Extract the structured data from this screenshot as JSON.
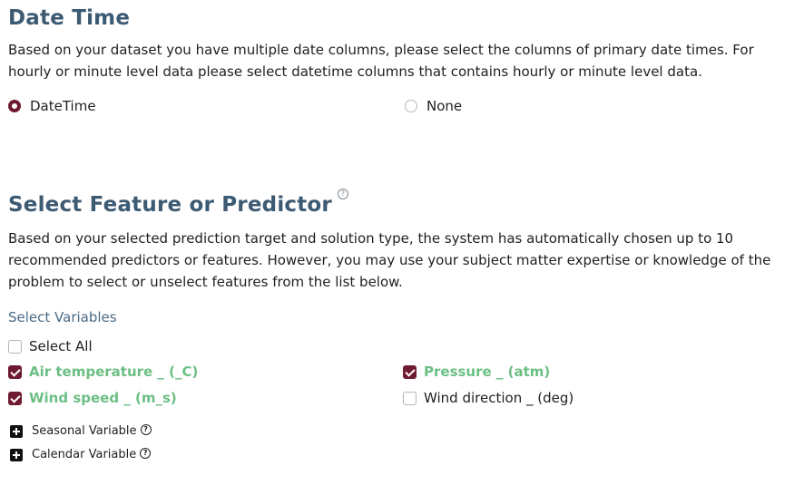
{
  "date_time": {
    "title": "Date Time",
    "description": "Based on your dataset you have multiple date columns, please select the columns of primary date times. For hourly or minute level data please select datetime columns that contains hourly or minute level data.",
    "options": [
      {
        "label": "DateTime",
        "selected": true
      },
      {
        "label": "None",
        "selected": false
      }
    ]
  },
  "feature_section": {
    "title": "Select Feature or Predictor",
    "help_icon": "question-circle-icon",
    "description": "Based on your selected prediction target and solution type, the system has automatically chosen up to 10 recommended predictors or features. However, you may use your subject matter expertise or knowledge of the problem to select or unselect features from the list below.",
    "select_variables_label": "Select Variables",
    "select_all_label": "Select All",
    "variables": [
      {
        "label": "Air temperature _ (_C)",
        "checked": true
      },
      {
        "label": "Pressure _ (atm)",
        "checked": true
      },
      {
        "label": "Wind speed _ (m_s)",
        "checked": true
      },
      {
        "label": "Wind direction _ (deg)",
        "checked": false
      }
    ],
    "expanders": [
      {
        "label": "Seasonal Variable",
        "icon": "plus-square-icon"
      },
      {
        "label": "Calendar Variable",
        "icon": "plus-square-icon"
      }
    ]
  },
  "colors": {
    "heading": "#3d5a73",
    "accent": "#6e1a31",
    "checked_label": "#6cbf84"
  }
}
